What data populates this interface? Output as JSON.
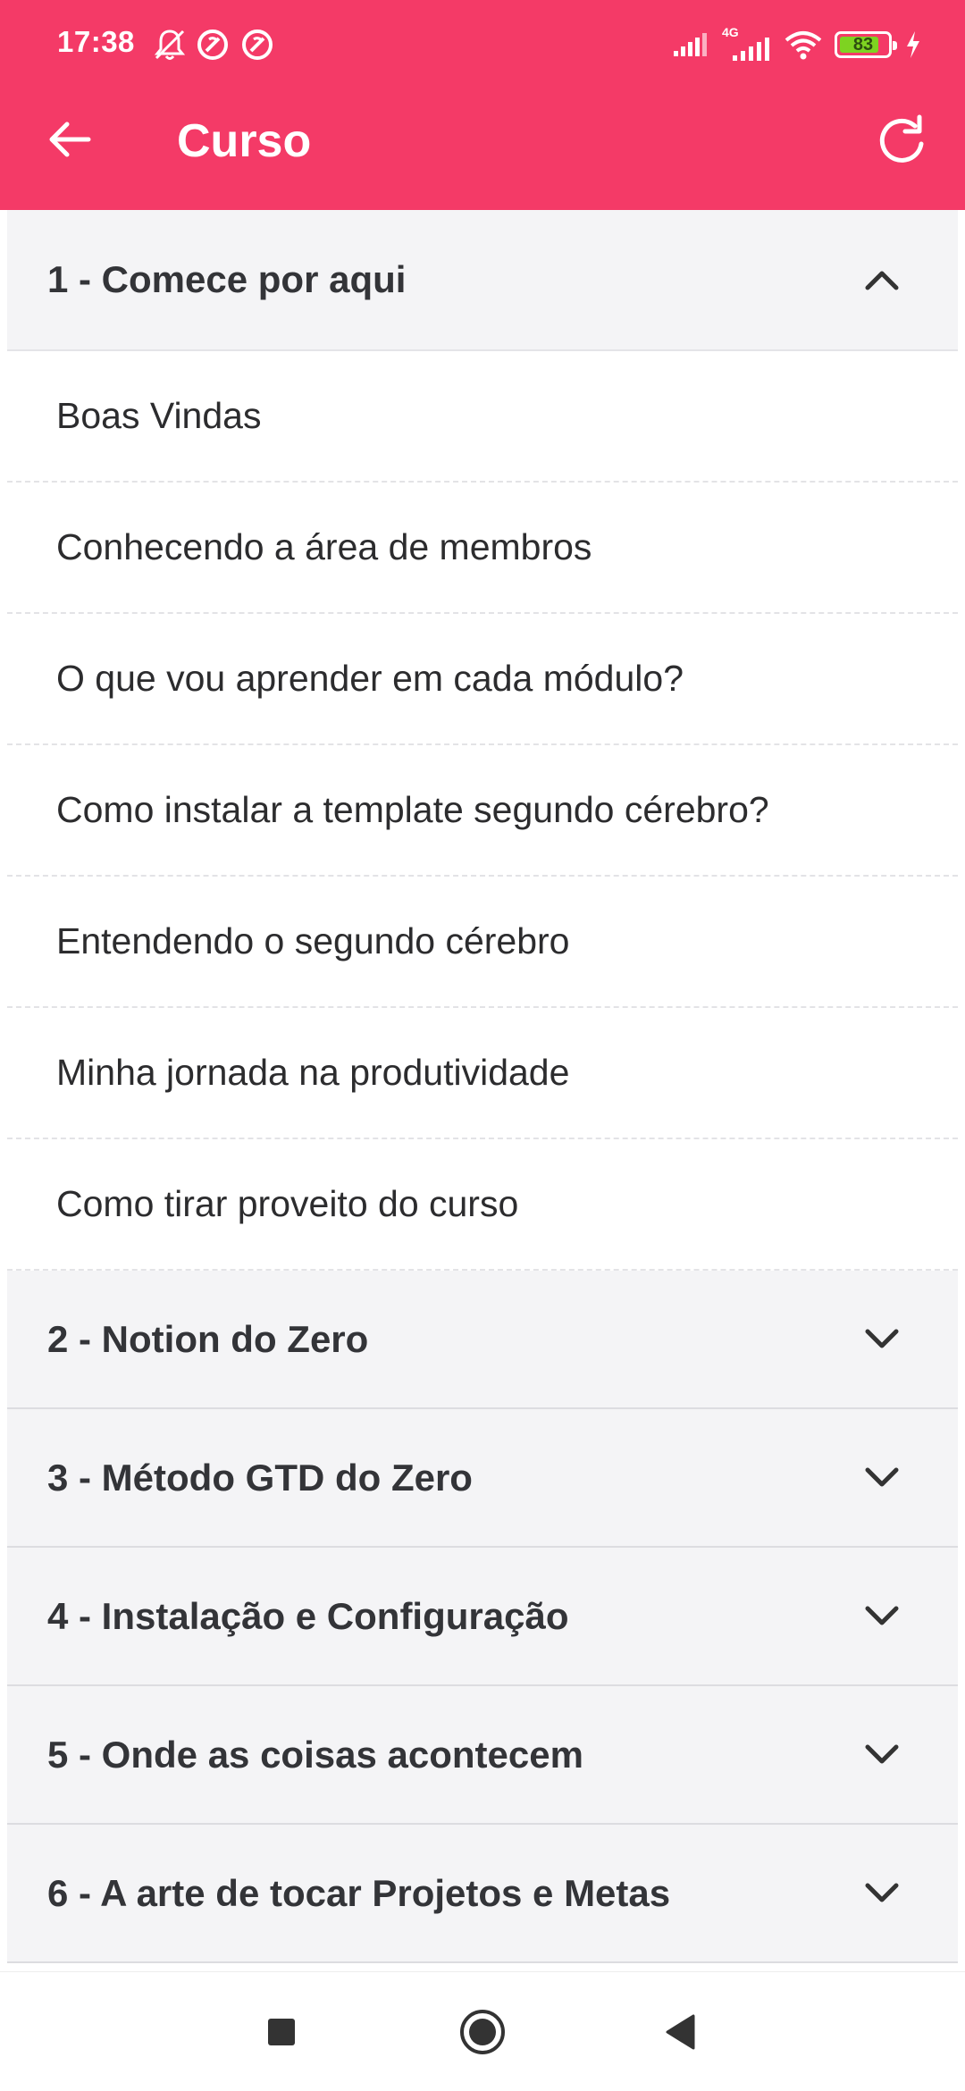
{
  "status_bar": {
    "time": "17:38",
    "network": "4G",
    "battery": "83",
    "battery_level": 0.83
  },
  "app_bar": {
    "title": "Curso",
    "back_icon": "arrow-left-icon",
    "refresh_icon": "refresh-icon"
  },
  "modules": [
    {
      "title": "1 - Comece por aqui",
      "expanded": true,
      "lessons": [
        "Boas Vindas",
        "Conhecendo a área de membros",
        "O que vou aprender em cada módulo?",
        "Como instalar a template segundo cérebro?",
        "Entendendo o segundo cérebro",
        "Minha jornada na produtividade",
        "Como tirar proveito do curso"
      ]
    },
    {
      "title": "2 - Notion do Zero",
      "expanded": false
    },
    {
      "title": "3 - Método GTD do Zero",
      "expanded": false
    },
    {
      "title": "4 - Instalação e Configuração",
      "expanded": false
    },
    {
      "title": "5 - Onde as coisas acontecem",
      "expanded": false
    },
    {
      "title": "6 - A arte de tocar Projetos e Metas",
      "expanded": false
    }
  ],
  "colors": {
    "accent": "#f43a67",
    "header_bg": "#f4f4f6",
    "battery_fill": "#7ed321"
  }
}
